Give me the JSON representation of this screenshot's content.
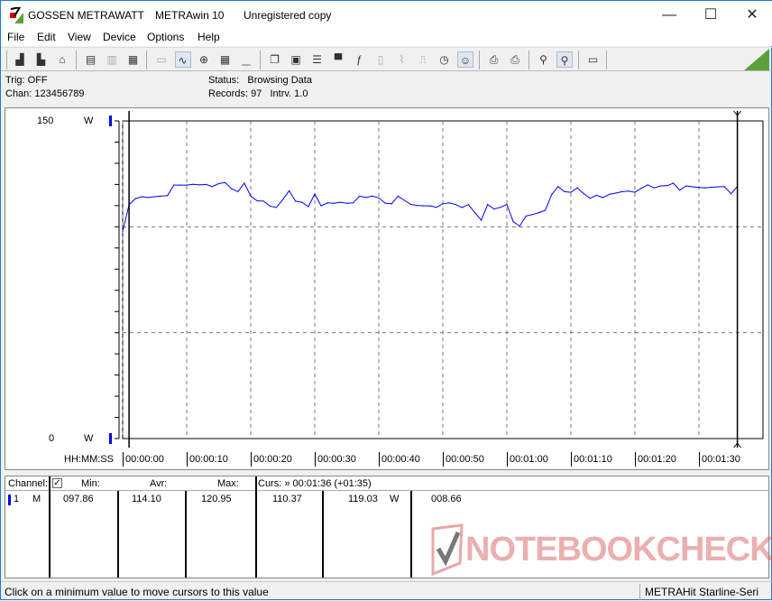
{
  "window": {
    "brand": "GOSSEN METRAWATT",
    "app": "METRAwin 10",
    "license": "Unregistered copy",
    "controls": [
      "—",
      "☐",
      "✕"
    ]
  },
  "menu": [
    "File",
    "Edit",
    "View",
    "Device",
    "Options",
    "Help"
  ],
  "toolbar": {
    "icons": [
      "save-as-icon",
      "save-icon",
      "open-icon",
      "device-read-icon",
      "device-memory-icon",
      "device-m-icon",
      "display-icon",
      "waveform-icon",
      "crosshair-icon",
      "table-icon",
      "bar-chart-icon",
      "copy-icon",
      "channel-icon",
      "list-icon",
      "computer-icon",
      "function-icon",
      "pc-icon",
      "signal-icon",
      "wave-grid-icon",
      "clock-icon",
      "robot-icon",
      "print-preview-icon",
      "print-icon",
      "zoom-wave-icon",
      "zoom-icon",
      "comment-icon"
    ],
    "accent": "#5ba13a"
  },
  "info": {
    "trig": "Trig: OFF",
    "chan": "Chan:  123456789",
    "status": "Status:   Browsing Data",
    "records": "Records: 97   Intrv. 1.0"
  },
  "chart_data": {
    "type": "line",
    "ylim": [
      0,
      150
    ],
    "yunit": "W",
    "ytick_labels": [
      "150",
      "0"
    ],
    "xlabel": "HH:MM:SS",
    "xtick_labels": [
      "00:00:00",
      "00:00:10",
      "00:00:20",
      "00:00:30",
      "00:00:40",
      "00:00:50",
      "00:01:00",
      "00:01:10",
      "00:01:20",
      "00:01:30"
    ],
    "x_interval_s": 1,
    "grid": true,
    "line_color": "#0000ff",
    "cursors": [
      "00:00:01",
      "00:01:36"
    ],
    "values": [
      97.9,
      110.4,
      113.3,
      114.2,
      113.8,
      114.2,
      114.5,
      114.7,
      119.7,
      119.7,
      119.7,
      120.1,
      119.8,
      120.0,
      119.0,
      120.4,
      120.9,
      118.0,
      116.6,
      120.6,
      114.5,
      112.3,
      112.1,
      109.8,
      109.1,
      112.8,
      117.0,
      112.1,
      111.6,
      109.5,
      115.5,
      109.9,
      111.3,
      111.1,
      111.6,
      111.1,
      111.3,
      114.5,
      113.8,
      114.5,
      113.6,
      111.2,
      110.9,
      114.5,
      112.5,
      110.6,
      110.1,
      109.9,
      109.9,
      109.2,
      110.9,
      111.3,
      110.5,
      109.1,
      110.5,
      106.7,
      103.1,
      110.5,
      108.4,
      109.2,
      110.6,
      102.4,
      100.3,
      105.1,
      105.8,
      106.7,
      107.8,
      115.2,
      119.0,
      116.6,
      116.3,
      118.4,
      115.7,
      113.5,
      114.9,
      113.8,
      115.3,
      115.9,
      116.6,
      116.9,
      116.3,
      118.2,
      119.8,
      118.4,
      119.3,
      119.4,
      120.6,
      117.3,
      119.3,
      118.9,
      118.6,
      118.4,
      118.7,
      118.9,
      119.0,
      115.6,
      119.0
    ]
  },
  "table": {
    "headers": {
      "channel": "Channel:",
      "min": "Min:",
      "avr": "Avr:",
      "max": "Max:",
      "curs": "Curs: » 00:01:36 (+01:35)"
    },
    "row": {
      "num": "1",
      "mode": "M",
      "min": "097.86",
      "avr": "114.10",
      "max": "120.95",
      "c1": "110.37",
      "c2": "119.03",
      "unit": "W",
      "diff": "008.66"
    }
  },
  "watermark": "NOTEBOOKCHECK",
  "statusbar": {
    "hint": "Click on a minimum value to move cursors to this value",
    "device": "METRAHit Starline-Seri"
  }
}
